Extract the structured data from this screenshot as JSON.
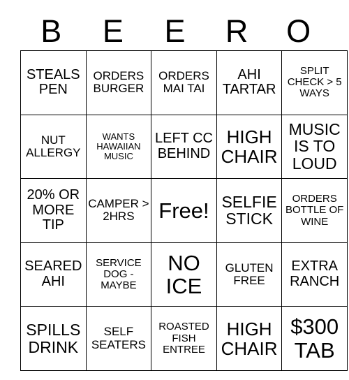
{
  "card": {
    "header_letters": [
      "B",
      "E",
      "E",
      "R",
      "O"
    ],
    "rows": [
      [
        {
          "text": "STEALS PEN",
          "size": "lg"
        },
        {
          "text": "ORDERS BURGER",
          "size": "md"
        },
        {
          "text": "ORDERS MAI TAI",
          "size": "md"
        },
        {
          "text": "AHI TARTAR",
          "size": "lg"
        },
        {
          "text": "SPLIT CHECK > 5 WAYS",
          "size": "sm"
        }
      ],
      [
        {
          "text": "NUT ALLERGY",
          "size": "md"
        },
        {
          "text": "WANTS HAWAIIAN MUSIC",
          "size": "xs"
        },
        {
          "text": "LEFT CC BEHIND",
          "size": "lg"
        },
        {
          "text": "HIGH CHAIR",
          "size": "xxl"
        },
        {
          "text": "MUSIC IS TO LOUD",
          "size": "xl"
        }
      ],
      [
        {
          "text": "20% OR MORE TIP",
          "size": "lg"
        },
        {
          "text": "CAMPER > 2HRS",
          "size": "md"
        },
        {
          "text": "Free!",
          "size": "huge"
        },
        {
          "text": "SELFIE STICK",
          "size": "xl"
        },
        {
          "text": "ORDERS BOTTLE OF WINE",
          "size": "sm"
        }
      ],
      [
        {
          "text": "SEARED AHI",
          "size": "lg"
        },
        {
          "text": "SERVICE DOG - MAYBE",
          "size": "sm"
        },
        {
          "text": "NO ICE",
          "size": "huge"
        },
        {
          "text": "GLUTEN FREE",
          "size": "md"
        },
        {
          "text": "EXTRA RANCH",
          "size": "lg"
        }
      ],
      [
        {
          "text": "SPILLS DRINK",
          "size": "xl"
        },
        {
          "text": "SELF SEATERS",
          "size": "md"
        },
        {
          "text": "ROASTED FISH ENTREE",
          "size": "sm"
        },
        {
          "text": "HIGH CHAIR",
          "size": "xxl"
        },
        {
          "text": "$300 TAB",
          "size": "huge"
        }
      ]
    ]
  }
}
